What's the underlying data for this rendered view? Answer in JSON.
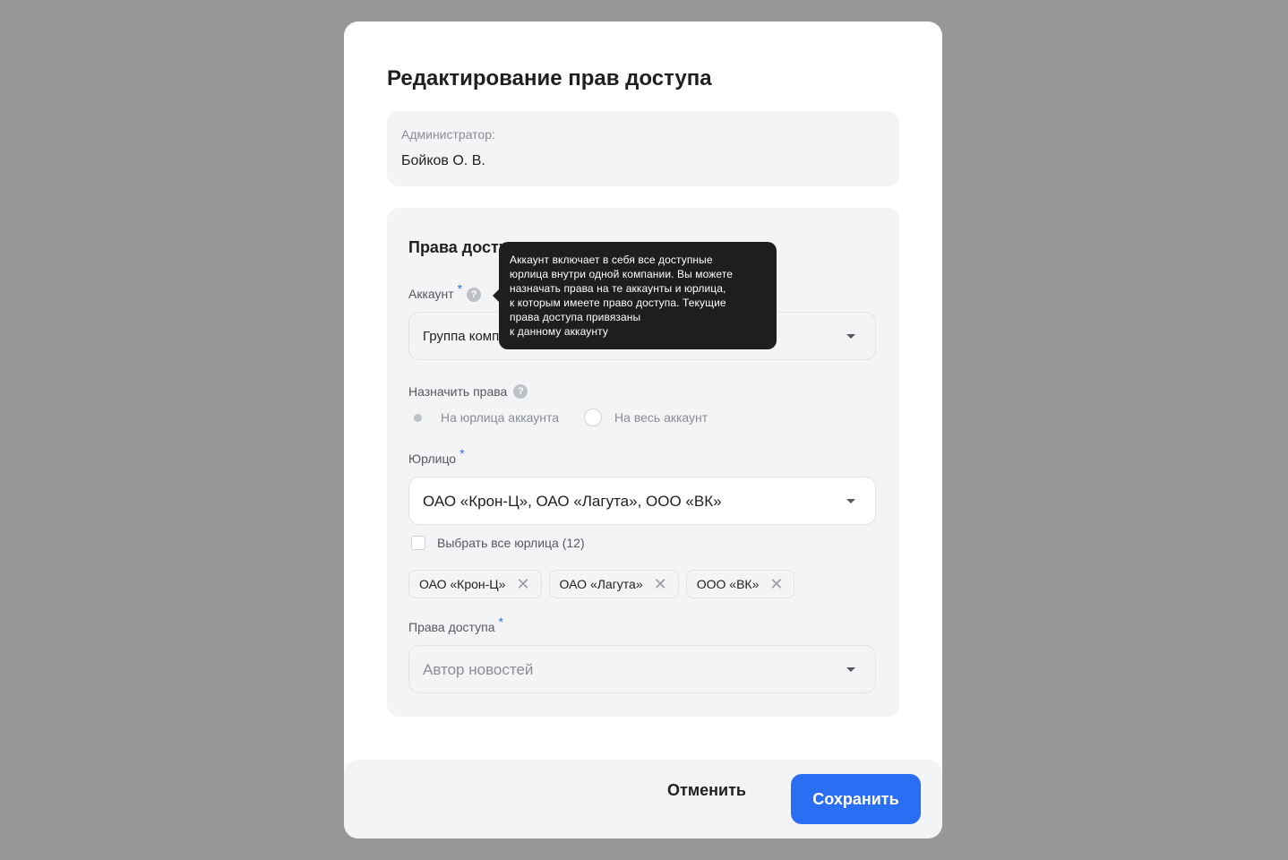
{
  "dialog": {
    "title": "Редактирование прав доступа"
  },
  "admin": {
    "label": "Администратор:",
    "value": "Бойков О. В."
  },
  "rights": {
    "section_title": "Права доступа",
    "account": {
      "label": "Аккаунт",
      "required_mark": "*",
      "help_icon": "?",
      "value": "Группа компаний"
    },
    "assign": {
      "label": "Назначить права",
      "help_icon": "?",
      "options": [
        {
          "label": "На юрлица аккаунта",
          "checked": true
        },
        {
          "label": "На весь аккаунт",
          "checked": false
        }
      ]
    },
    "entity": {
      "label": "Юрлицо",
      "required_mark": "*",
      "value": "ОАО «Крон-Ц», ОАО «Лагута», ООО «ВК»",
      "select_all": "Выбрать все юрлица (12)",
      "tags": [
        {
          "label": "ОАО «Крон-Ц»",
          "remove": "✕"
        },
        {
          "label": "ОАО «Лагута»",
          "remove": "✕"
        },
        {
          "label": "ООО «ВК»",
          "remove": "✕"
        }
      ]
    },
    "access": {
      "label": "Права доступа",
      "required_mark": "*",
      "placeholder": "Автор новостей"
    }
  },
  "tooltip": {
    "lines": [
      "Аккаунт включает в себя все доступные",
      "юрлица внутри одной компании. Вы можете",
      "назначать права на те аккаунты и юрлица,",
      "к которым имеете право доступа. Текущие",
      "права доступа привязаны",
      "к данному аккаунту"
    ]
  },
  "footer": {
    "cancel_label": "Отменить",
    "save_label": "Сохранить"
  },
  "colors": {
    "backdrop": "#979797",
    "primary": "#2a6ff3",
    "card": "#f3f4f6",
    "tooltip": "#1e1e20"
  }
}
